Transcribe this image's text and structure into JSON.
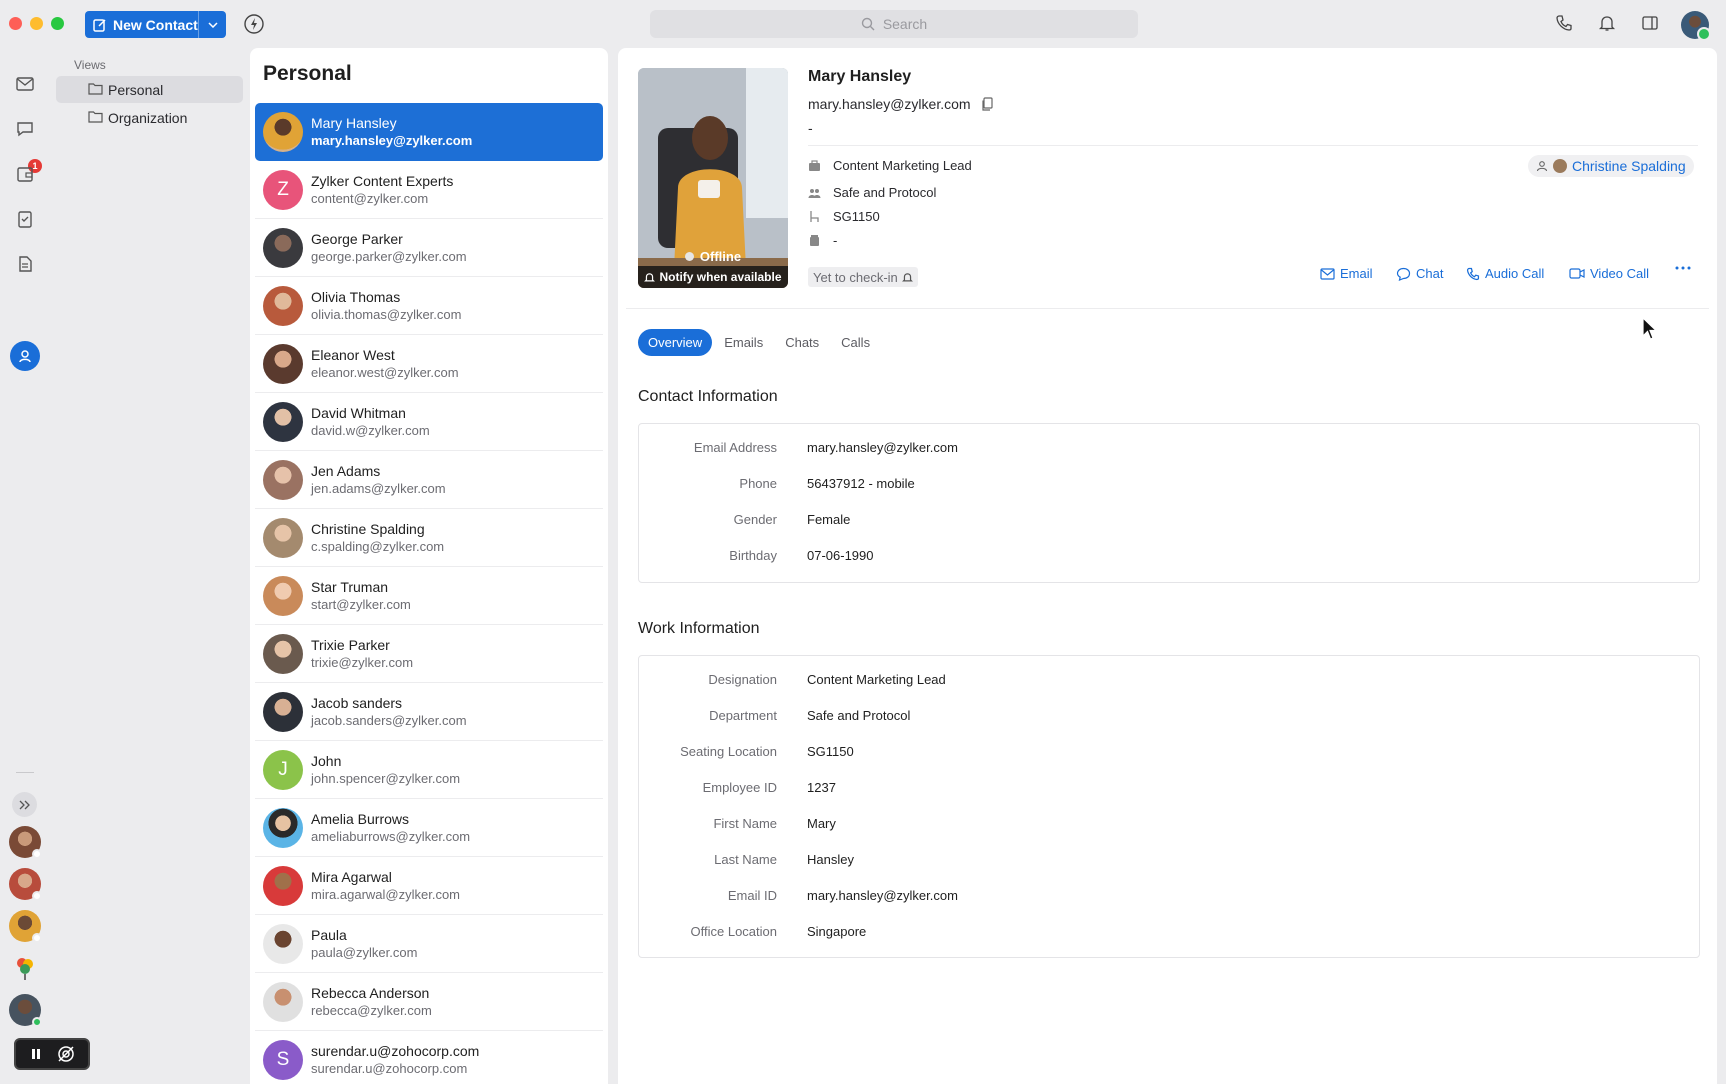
{
  "toolbar": {
    "new_contact_label": "New Contact",
    "search_placeholder": "Search"
  },
  "rail": {
    "chat_badge": "1"
  },
  "views": {
    "title": "Views",
    "items": [
      {
        "label": "Personal",
        "active": true
      },
      {
        "label": "Organization",
        "active": false
      }
    ]
  },
  "list": {
    "title": "Personal",
    "contacts": [
      {
        "name": "Mary Hansley",
        "email": "mary.hansley@zylker.com"
      },
      {
        "name": "Zylker Content Experts",
        "email": "content@zylker.com",
        "letter": "Z"
      },
      {
        "name": "George Parker",
        "email": "george.parker@zylker.com"
      },
      {
        "name": "Olivia Thomas",
        "email": "olivia.thomas@zylker.com"
      },
      {
        "name": "Eleanor West",
        "email": "eleanor.west@zylker.com"
      },
      {
        "name": "David Whitman",
        "email": "david.w@zylker.com"
      },
      {
        "name": "Jen Adams",
        "email": "jen.adams@zylker.com"
      },
      {
        "name": "Christine Spalding",
        "email": "c.spalding@zylker.com"
      },
      {
        "name": "Star Truman",
        "email": "start@zylker.com"
      },
      {
        "name": "Trixie Parker",
        "email": "trixie@zylker.com"
      },
      {
        "name": "Jacob sanders",
        "email": "jacob.sanders@zylker.com"
      },
      {
        "name": "John",
        "email": "john.spencer@zylker.com",
        "letter": "J"
      },
      {
        "name": "Amelia Burrows",
        "email": "ameliaburrows@zylker.com"
      },
      {
        "name": "Mira Agarwal",
        "email": "mira.agarwal@zylker.com"
      },
      {
        "name": "Paula",
        "email": "paula@zylker.com"
      },
      {
        "name": "Rebecca Anderson",
        "email": "rebecca@zylker.com"
      },
      {
        "name": "surendar.u@zohocorp.com",
        "email": "surendar.u@zohocorp.com",
        "letter": "S"
      }
    ]
  },
  "detail": {
    "status": "Offline",
    "notify": "Notify when available",
    "name": "Mary Hansley",
    "email": "mary.hansley@zylker.com",
    "extension": "-",
    "designation": "Content Marketing Lead",
    "department": "Safe and Protocol",
    "seating": "SG1150",
    "desk_phone": "-",
    "manager": "Christine Spalding",
    "checkin": "Yet to check-in",
    "actions": {
      "email": "Email",
      "chat": "Chat",
      "audio": "Audio Call",
      "video": "Video Call"
    },
    "tabs": [
      "Overview",
      "Emails",
      "Chats",
      "Calls"
    ],
    "contact_section": {
      "title": "Contact Information",
      "fields": [
        {
          "label": "Email Address",
          "value": "mary.hansley@zylker.com"
        },
        {
          "label": "Phone",
          "value": "56437912 - mobile"
        },
        {
          "label": "Gender",
          "value": "Female"
        },
        {
          "label": "Birthday",
          "value": "07-06-1990"
        }
      ]
    },
    "work_section": {
      "title": "Work Information",
      "fields": [
        {
          "label": "Designation",
          "value": "Content Marketing Lead"
        },
        {
          "label": "Department",
          "value": "Safe and Protocol"
        },
        {
          "label": "Seating Location",
          "value": "SG1150"
        },
        {
          "label": "Employee ID",
          "value": "1237"
        },
        {
          "label": "First Name",
          "value": "Mary"
        },
        {
          "label": "Last Name",
          "value": "Hansley"
        },
        {
          "label": "Email ID",
          "value": "mary.hansley@zylker.com"
        },
        {
          "label": "Office Location",
          "value": "Singapore"
        }
      ]
    }
  },
  "colors": {
    "accent": "#1a6ed8",
    "badge": "#e53935",
    "online": "#2fbf5c"
  }
}
